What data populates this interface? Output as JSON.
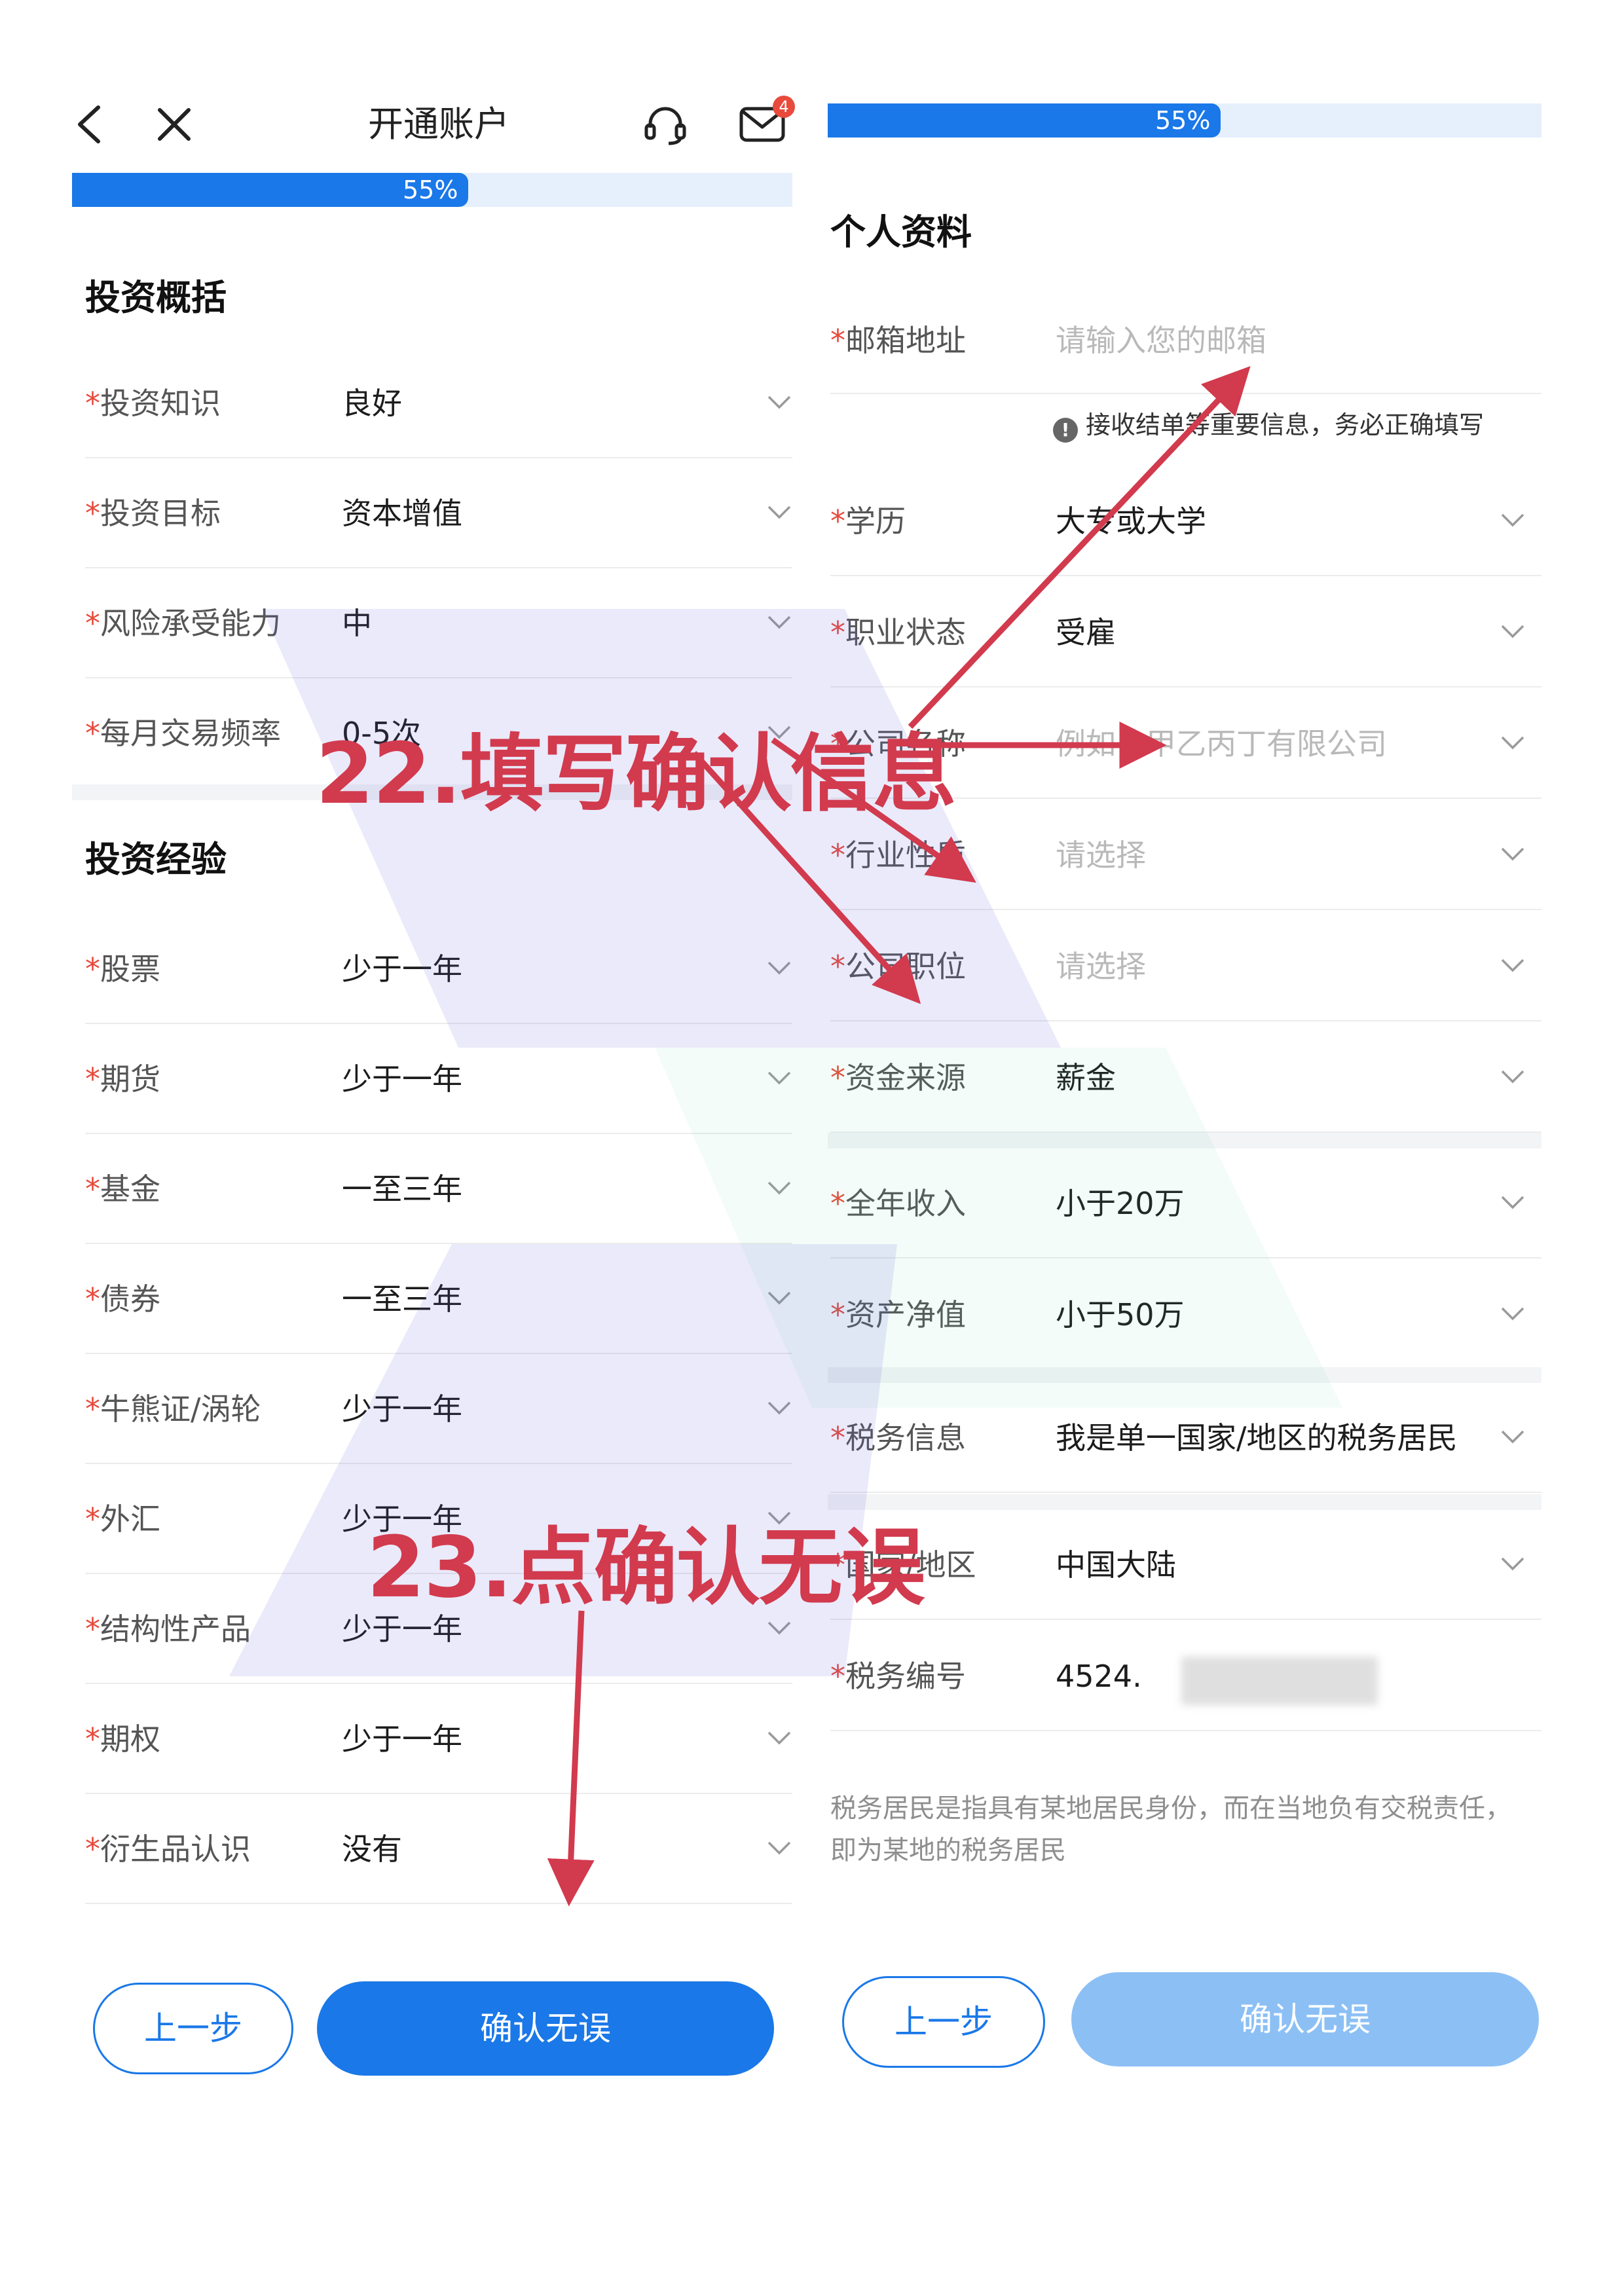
{
  "left": {
    "header": {
      "title": "开通账户",
      "back_icon": "back-chevron-icon",
      "close_icon": "close-icon",
      "service_icon": "headset-icon",
      "mail_icon": "mail-icon",
      "mail_badge": "4"
    },
    "progress": {
      "value": 0.55,
      "label": "55%"
    },
    "section1": {
      "title": "投资概括",
      "rows": [
        {
          "label": "投资知识",
          "value": "良好"
        },
        {
          "label": "投资目标",
          "value": "资本增值"
        },
        {
          "label": "风险承受能力",
          "value": "中"
        },
        {
          "label": "每月交易频率",
          "value": "0-5次"
        }
      ]
    },
    "section2": {
      "title": "投资经验",
      "rows": [
        {
          "label": "股票",
          "value": "少于一年"
        },
        {
          "label": "期货",
          "value": "少于一年"
        },
        {
          "label": "基金",
          "value": "一至三年"
        },
        {
          "label": "债券",
          "value": "一至三年"
        },
        {
          "label": "牛熊证/涡轮",
          "value": "少于一年"
        },
        {
          "label": "外汇",
          "value": "少于一年"
        },
        {
          "label": "结构性产品",
          "value": "少于一年"
        },
        {
          "label": "期权",
          "value": "少于一年"
        },
        {
          "label": "衍生品认识",
          "value": "没有"
        }
      ]
    },
    "buttons": {
      "prev": "上一步",
      "confirm": "确认无误"
    }
  },
  "right": {
    "progress": {
      "value": 0.55,
      "label": "55%"
    },
    "section": {
      "title": "个人资料"
    },
    "email": {
      "label": "邮箱地址",
      "placeholder": "请输入您的邮箱",
      "note": "接收结单等重要信息，务必正确填写"
    },
    "rows": [
      {
        "label": "学历",
        "value": "大专或大学",
        "placeholder": false
      },
      {
        "label": "职业状态",
        "value": "受雇",
        "placeholder": false
      },
      {
        "label": "公司名称",
        "value": "例如：甲乙丙丁有限公司",
        "placeholder": true
      },
      {
        "label": "行业性质",
        "value": "请选择",
        "placeholder": true
      },
      {
        "label": "公司职位",
        "value": "请选择",
        "placeholder": true
      },
      {
        "label": "资金来源",
        "value": "薪金",
        "placeholder": false
      }
    ],
    "rows2": [
      {
        "label": "全年收入",
        "value": "小于20万"
      },
      {
        "label": "资产净值",
        "value": "小于50万"
      }
    ],
    "tax": {
      "label": "税务信息",
      "value": "我是单一国家/地区的税务居民"
    },
    "country": {
      "label": "国家/地区",
      "value": "中国大陆"
    },
    "tax_id": {
      "label": "税务编号",
      "value": "4524."
    },
    "explain": "税务居民是指具有某地居民身份，而在当地负有交税责任，即为某地的税务居民",
    "buttons": {
      "prev": "上一步",
      "confirm": "确认无误"
    }
  },
  "annotations": {
    "step22": "22.填写确认信息",
    "step23": "23.点确认无误"
  },
  "colors": {
    "primary": "#1a78e8",
    "primary_disabled": "#8cc0f5",
    "required_star": "#e84a3c",
    "annotation": "#d23a4e"
  }
}
